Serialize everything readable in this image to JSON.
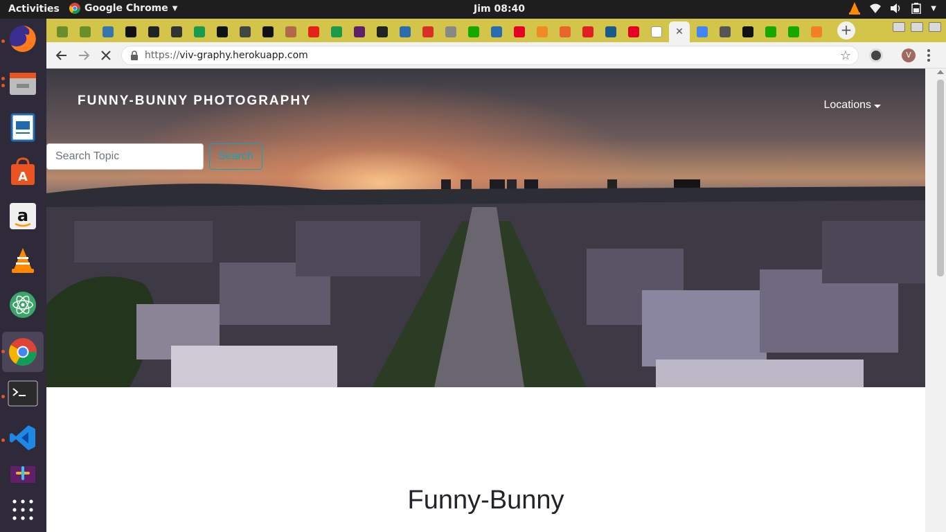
{
  "topbar": {
    "activities": "Activities",
    "app_name": "Google Chrome",
    "clock": "Jim 08:40"
  },
  "dock": {
    "items": [
      {
        "name": "firefox-icon",
        "color": "#e66000"
      },
      {
        "name": "files-icon",
        "color": "#8a8a8a"
      },
      {
        "name": "libreoffice-impress-icon",
        "color": "#1f6bb0"
      },
      {
        "name": "software-center-icon",
        "color": "#e95420"
      },
      {
        "name": "amazon-icon",
        "color": "#f0f0f0"
      },
      {
        "name": "vlc-icon",
        "color": "#ff8800"
      },
      {
        "name": "atom-icon",
        "color": "#3aa66a"
      },
      {
        "name": "chrome-icon",
        "color": "#4285f4"
      },
      {
        "name": "terminal-icon",
        "color": "#2b2b2b"
      },
      {
        "name": "vscode-icon",
        "color": "#1e88e5"
      },
      {
        "name": "slack-icon",
        "color": "#611f69"
      }
    ],
    "apps_grid": "show-applications-icon"
  },
  "tabs": [
    {
      "icon": "palm-tree-icon",
      "color": "#6a8f2a"
    },
    {
      "icon": "palm-tree-icon",
      "color": "#6a8f2a"
    },
    {
      "icon": "python-icon",
      "color": "#3776ab"
    },
    {
      "icon": "medium-icon",
      "color": "#111111"
    },
    {
      "icon": "github-icon",
      "color": "#222222"
    },
    {
      "icon": "star-icon",
      "color": "#333333"
    },
    {
      "icon": "cross-icon",
      "color": "#1a9a4a"
    },
    {
      "icon": "medium-icon",
      "color": "#111111"
    },
    {
      "icon": "flag-icon",
      "color": "#444444"
    },
    {
      "icon": "medium-icon",
      "color": "#111111"
    },
    {
      "icon": "avatar-icon",
      "color": "#b06a4a"
    },
    {
      "icon": "youtube-icon",
      "color": "#e62117"
    },
    {
      "icon": "cross-icon",
      "color": "#1a9a4a"
    },
    {
      "icon": "slack-icon",
      "color": "#611f69"
    },
    {
      "icon": "github-icon",
      "color": "#222222"
    },
    {
      "icon": "code-icon",
      "color": "#2b6cb0"
    },
    {
      "icon": "gmail-icon",
      "color": "#d93025"
    },
    {
      "icon": "document-icon",
      "color": "#888888"
    },
    {
      "icon": "upwork-icon",
      "color": "#14a800"
    },
    {
      "icon": "code-icon",
      "color": "#2b6cb0"
    },
    {
      "icon": "pinterest-icon",
      "color": "#e60023"
    },
    {
      "icon": "sparkle-icon",
      "color": "#f08a24"
    },
    {
      "icon": "codepen-icon",
      "color": "#e8652a"
    },
    {
      "icon": "close-x-icon",
      "color": "#e02020"
    },
    {
      "icon": "wave-icon",
      "color": "#1a5a8a"
    },
    {
      "icon": "pinterest-icon",
      "color": "#e60023"
    },
    {
      "icon": "page-icon",
      "color": "#ffffff"
    },
    {
      "icon": "close-icon",
      "color": "#555555",
      "active": true
    },
    {
      "icon": "google-icon",
      "color": "#4285f4"
    },
    {
      "icon": "book-icon",
      "color": "#555555"
    },
    {
      "icon": "medium-icon",
      "color": "#111111"
    },
    {
      "icon": "upwork-icon",
      "color": "#14a800"
    },
    {
      "icon": "upwork-icon",
      "color": "#14a800"
    },
    {
      "icon": "stackoverflow-icon",
      "color": "#f48024"
    }
  ],
  "toolbar": {
    "url_scheme": "https://",
    "url_host": "viv-graphy.herokuapp.com",
    "profile_initial": "V"
  },
  "page": {
    "brand": "FUNNY-BUNNY PHOTOGRAPHY",
    "nav_locations": "Locations",
    "search_placeholder": "Search Topic",
    "search_button": "Search",
    "main_title": "Funny-Bunny"
  },
  "colors": {
    "tabstrip": "#d3c44a",
    "search_outline": "#17a2b8"
  }
}
